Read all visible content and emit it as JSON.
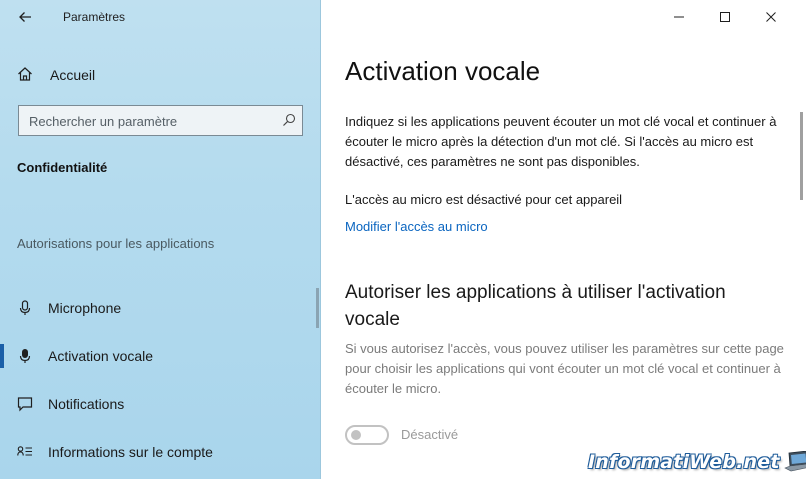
{
  "window": {
    "title": "Paramètres"
  },
  "sidebar": {
    "home_label": "Accueil",
    "search_placeholder": "Rechercher un paramètre",
    "section_title": "Confidentialité",
    "group_label": "Autorisations pour les applications",
    "items": [
      {
        "label": "Microphone",
        "icon": "microphone-icon"
      },
      {
        "label": "Activation vocale",
        "icon": "microphone-icon",
        "active": true
      },
      {
        "label": "Notifications",
        "icon": "notification-icon"
      },
      {
        "label": "Informations sur le compte",
        "icon": "account-info-icon"
      }
    ]
  },
  "main": {
    "title": "Activation vocale",
    "description": "Indiquez si les applications peuvent écouter un mot clé vocal et continuer à écouter le micro après la détection d'un mot clé. Si l'accès au micro est désactivé, ces paramètres ne sont pas disponibles.",
    "mic_status": "L'accès au micro est désactivé pour cet appareil",
    "mic_link": "Modifier l'accès au micro",
    "allow_heading": "Autoriser les applications à utiliser l'activation vocale",
    "allow_description": "Si vous autorisez l'accès, vous pouvez utiliser les paramètres sur cette page pour choisir les applications qui vont écouter un mot clé vocal et continuer à écouter le micro.",
    "toggle_state_label": "Désactivé",
    "toggle_on": false
  },
  "watermark": {
    "text": "InformatiWeb.net"
  },
  "colors": {
    "accent": "#1a5fa8",
    "link": "#0a65c0",
    "sidebar_bg": "#b4dbee"
  }
}
